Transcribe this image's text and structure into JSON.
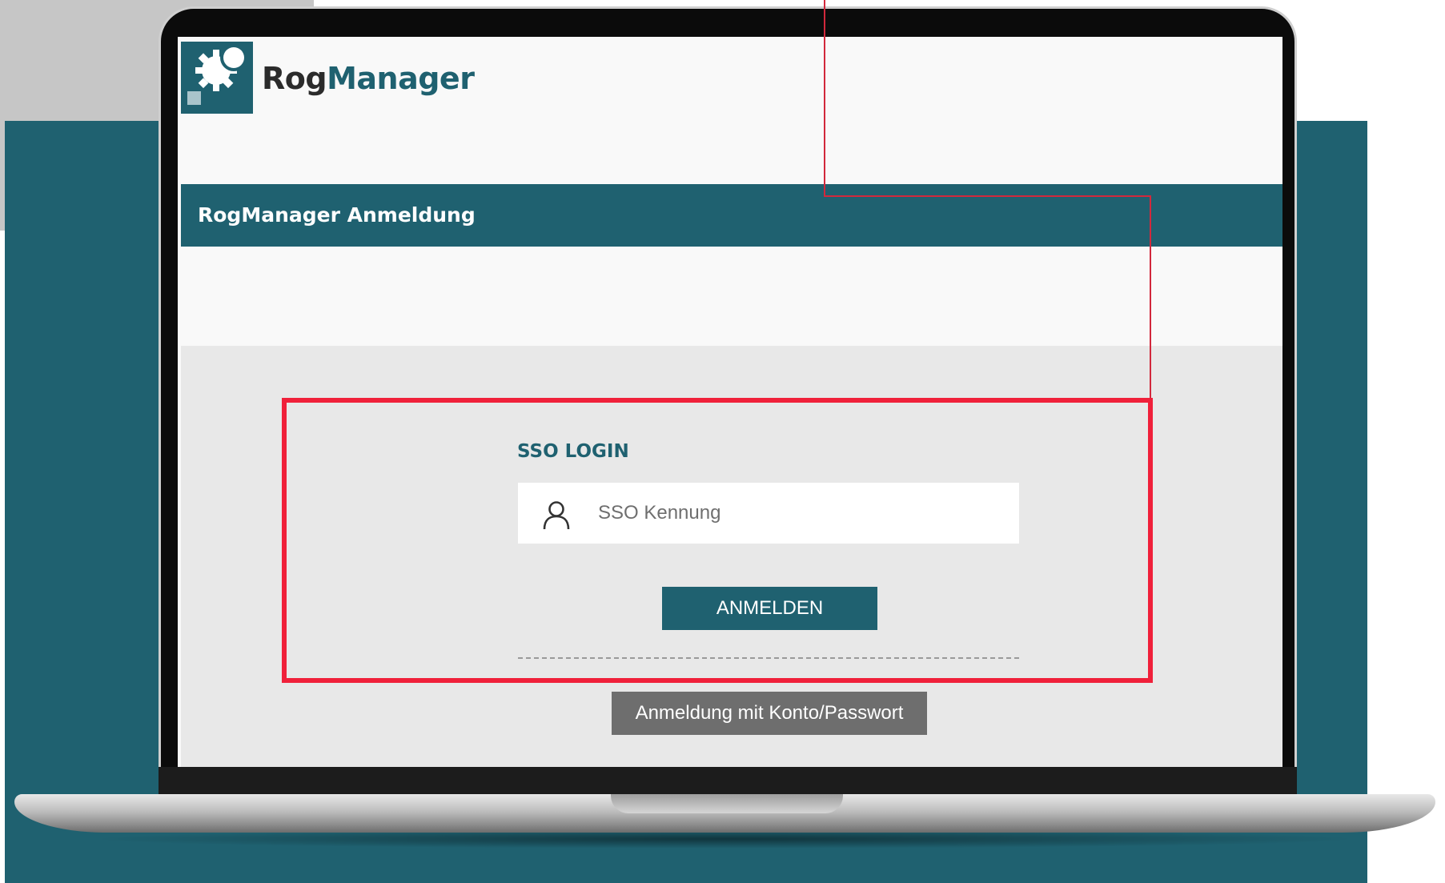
{
  "header": {
    "brand_part1": "Rog",
    "brand_part2": "Manager",
    "logo_icon": "gear-logo-icon"
  },
  "title_bar": {
    "title": "RogManager Anmeldung"
  },
  "sso": {
    "label": "SSO LOGIN",
    "input_placeholder": "SSO Kennung",
    "input_value": "",
    "user_icon": "user-icon",
    "submit_label": "ANMELDEN",
    "alt_login_label": "Anmeldung mit Konto/Passwort"
  },
  "colors": {
    "brand_teal": "#1f6170",
    "annotation_red": "#f0203a",
    "secondary_button": "#6e6e6e"
  }
}
